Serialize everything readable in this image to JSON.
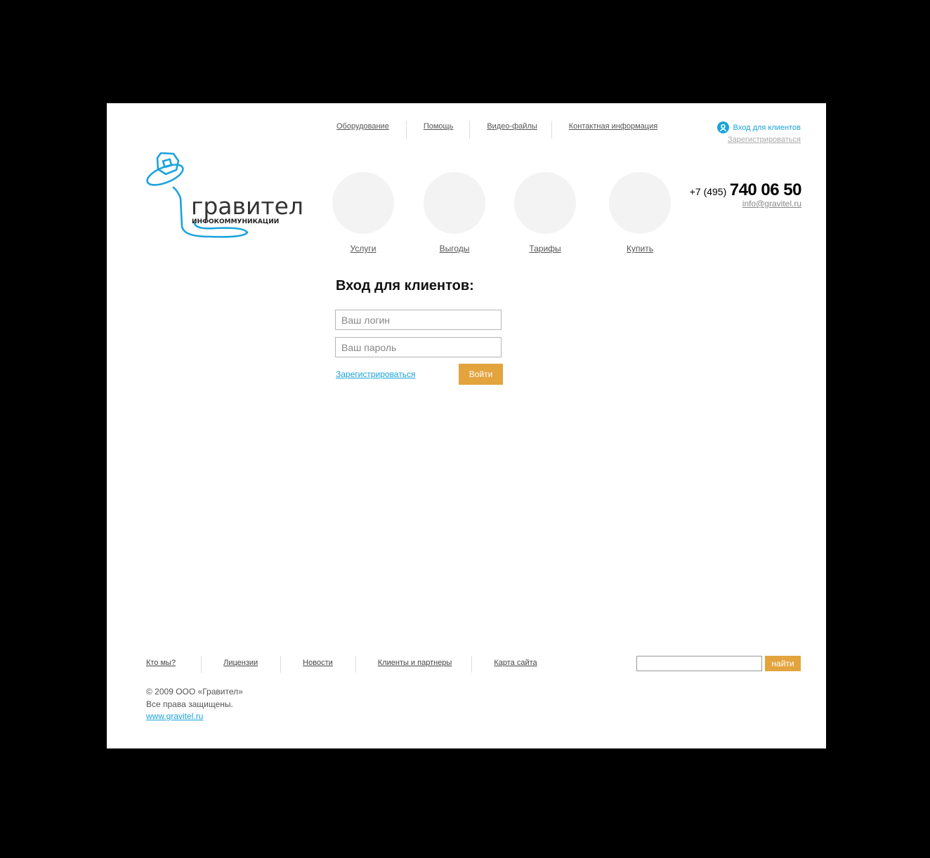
{
  "header": {
    "nav": [
      "Оборудование",
      "Помощь",
      "Видео-файлы",
      "Контактная информация"
    ],
    "client_login": "Вход для клиентов",
    "register": "Зарегистрироваться"
  },
  "logo": {
    "name": "гравител",
    "tagline": "ИНФОКОММУНИКАЦИИ",
    "color": "#1aa3dc"
  },
  "circles": [
    "Услуги",
    "Выгоды",
    "Тарифы",
    "Купить"
  ],
  "contact": {
    "phone_code": "+7 (495)",
    "phone_number": "740 06 50",
    "email": "info@gravitel.ru"
  },
  "login_form": {
    "title": "Вход для клиентов:",
    "login_placeholder": "Ваш логин",
    "password_placeholder": "Ваш пароль",
    "register": "Зарегистрироваться",
    "submit": "Войти"
  },
  "footer": {
    "nav": [
      "Кто мы?",
      "Лицензии",
      "Новости",
      "Клиенты и партнеры",
      "Карта сайта"
    ],
    "search_button": "найти",
    "copyright_line1": "© 2009 ООО «Гравител»",
    "copyright_line2": "Все права защищены.",
    "site": "www.gravitel.ru"
  },
  "colors": {
    "accent": "#1aa3dc",
    "button": "#e3a43e",
    "circle": "#f3f3f3"
  }
}
